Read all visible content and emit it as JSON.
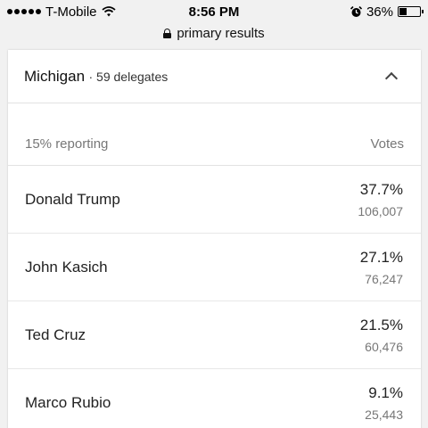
{
  "status_bar": {
    "carrier": "T-Mobile",
    "time": "8:56 PM",
    "battery": "36%",
    "battery_level": 0.36
  },
  "url_bar": {
    "title": "primary results"
  },
  "card": {
    "state": "Michigan",
    "delegates": "· 59 delegates",
    "reporting": "15% reporting",
    "votes_header": "Votes",
    "candidates": [
      {
        "name": "Donald Trump",
        "pct": "37.7%",
        "votes": "106,007"
      },
      {
        "name": "John Kasich",
        "pct": "27.1%",
        "votes": "76,247"
      },
      {
        "name": "Ted Cruz",
        "pct": "21.5%",
        "votes": "60,476"
      },
      {
        "name": "Marco Rubio",
        "pct": "9.1%",
        "votes": "25,443"
      }
    ]
  }
}
